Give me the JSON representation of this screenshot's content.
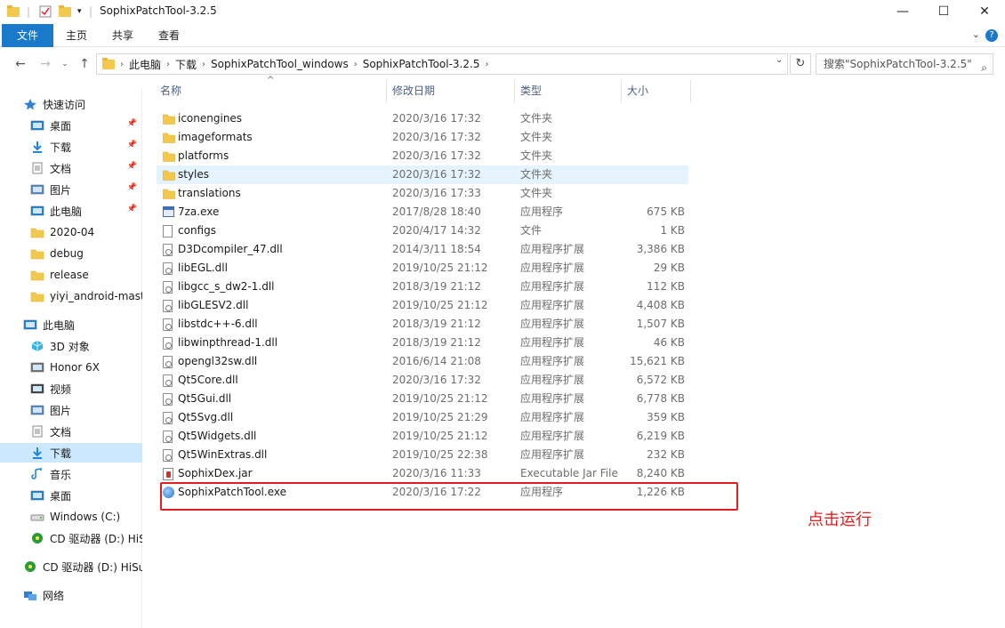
{
  "window": {
    "title": "SophixPatchTool-3.2.5",
    "controls": {
      "minimize": "—",
      "maximize": "☐",
      "close": "✕"
    }
  },
  "ribbon": {
    "tabs": [
      "文件",
      "主页",
      "共享",
      "查看"
    ]
  },
  "address": {
    "crumbs": [
      "此电脑",
      "下载",
      "SophixPatchTool_windows",
      "SophixPatchTool-3.2.5"
    ],
    "search_placeholder": "搜索\"SophixPatchTool-3.2.5\""
  },
  "sidebar": {
    "items": [
      {
        "label": "快速访问",
        "icon": "star-icon",
        "pinned": false
      },
      {
        "label": "桌面",
        "icon": "desktop-icon",
        "pinned": true
      },
      {
        "label": "下载",
        "icon": "download-icon",
        "pinned": true
      },
      {
        "label": "文档",
        "icon": "document-icon",
        "pinned": true
      },
      {
        "label": "图片",
        "icon": "picture-icon",
        "pinned": true
      },
      {
        "label": "此电脑",
        "icon": "computer-icon",
        "pinned": true
      },
      {
        "label": "2020-04",
        "icon": "folder-icon",
        "pinned": false
      },
      {
        "label": "debug",
        "icon": "folder-icon",
        "pinned": false
      },
      {
        "label": "release",
        "icon": "folder-icon",
        "pinned": false
      },
      {
        "label": "yiyi_android-mast",
        "icon": "folder-icon",
        "pinned": false
      },
      {
        "label": "此电脑",
        "icon": "computer-icon",
        "pinned": false
      },
      {
        "label": "3D 对象",
        "icon": "cube-icon",
        "pinned": false
      },
      {
        "label": "Honor 6X",
        "icon": "phone-icon",
        "pinned": false
      },
      {
        "label": "视频",
        "icon": "video-icon",
        "pinned": false
      },
      {
        "label": "图片",
        "icon": "picture-icon",
        "pinned": false
      },
      {
        "label": "文档",
        "icon": "document-icon",
        "pinned": false
      },
      {
        "label": "下载",
        "icon": "download-icon",
        "pinned": false
      },
      {
        "label": "音乐",
        "icon": "music-icon",
        "pinned": false
      },
      {
        "label": "桌面",
        "icon": "desktop-icon",
        "pinned": false
      },
      {
        "label": "Windows (C:)",
        "icon": "drive-icon",
        "pinned": false
      },
      {
        "label": "CD 驱动器 (D:) HiS",
        "icon": "cd-icon",
        "pinned": false
      },
      {
        "label": "CD 驱动器 (D:) HiSu",
        "icon": "cd-icon",
        "pinned": false
      },
      {
        "label": "网络",
        "icon": "network-icon",
        "pinned": false
      }
    ]
  },
  "columns": {
    "name": "名称",
    "date": "修改日期",
    "type": "类型",
    "size": "大小"
  },
  "files": [
    {
      "name": "iconengines",
      "date": "2020/3/16 17:32",
      "type": "文件夹",
      "size": "",
      "icon": "folder-icon"
    },
    {
      "name": "imageformats",
      "date": "2020/3/16 17:32",
      "type": "文件夹",
      "size": "",
      "icon": "folder-icon"
    },
    {
      "name": "platforms",
      "date": "2020/3/16 17:32",
      "type": "文件夹",
      "size": "",
      "icon": "folder-icon"
    },
    {
      "name": "styles",
      "date": "2020/3/16 17:32",
      "type": "文件夹",
      "size": "",
      "icon": "folder-icon"
    },
    {
      "name": "translations",
      "date": "2020/3/16 17:33",
      "type": "文件夹",
      "size": "",
      "icon": "folder-icon"
    },
    {
      "name": "7za.exe",
      "date": "2017/8/28 18:40",
      "type": "应用程序",
      "size": "675 KB",
      "icon": "exe-icon"
    },
    {
      "name": "configs",
      "date": "2020/4/17 14:32",
      "type": "文件",
      "size": "1 KB",
      "icon": "file-icon"
    },
    {
      "name": "D3Dcompiler_47.dll",
      "date": "2014/3/11 18:54",
      "type": "应用程序扩展",
      "size": "3,386 KB",
      "icon": "dll-icon"
    },
    {
      "name": "libEGL.dll",
      "date": "2019/10/25 21:12",
      "type": "应用程序扩展",
      "size": "29 KB",
      "icon": "dll-icon"
    },
    {
      "name": "libgcc_s_dw2-1.dll",
      "date": "2018/3/19 21:12",
      "type": "应用程序扩展",
      "size": "112 KB",
      "icon": "dll-icon"
    },
    {
      "name": "libGLESV2.dll",
      "date": "2019/10/25 21:12",
      "type": "应用程序扩展",
      "size": "4,408 KB",
      "icon": "dll-icon"
    },
    {
      "name": "libstdc++-6.dll",
      "date": "2018/3/19 21:12",
      "type": "应用程序扩展",
      "size": "1,507 KB",
      "icon": "dll-icon"
    },
    {
      "name": "libwinpthread-1.dll",
      "date": "2018/3/19 21:12",
      "type": "应用程序扩展",
      "size": "46 KB",
      "icon": "dll-icon"
    },
    {
      "name": "opengl32sw.dll",
      "date": "2016/6/14 21:08",
      "type": "应用程序扩展",
      "size": "15,621 KB",
      "icon": "dll-icon"
    },
    {
      "name": "Qt5Core.dll",
      "date": "2020/3/16 17:32",
      "type": "应用程序扩展",
      "size": "6,572 KB",
      "icon": "dll-icon"
    },
    {
      "name": "Qt5Gui.dll",
      "date": "2019/10/25 21:12",
      "type": "应用程序扩展",
      "size": "6,778 KB",
      "icon": "dll-icon"
    },
    {
      "name": "Qt5Svg.dll",
      "date": "2019/10/25 21:29",
      "type": "应用程序扩展",
      "size": "359 KB",
      "icon": "dll-icon"
    },
    {
      "name": "Qt5Widgets.dll",
      "date": "2019/10/25 21:12",
      "type": "应用程序扩展",
      "size": "6,219 KB",
      "icon": "dll-icon"
    },
    {
      "name": "Qt5WinExtras.dll",
      "date": "2019/10/25 22:38",
      "type": "应用程序扩展",
      "size": "232 KB",
      "icon": "dll-icon"
    },
    {
      "name": "SophixDex.jar",
      "date": "2020/3/16 11:33",
      "type": "Executable Jar File",
      "size": "8,240 KB",
      "icon": "jar-icon"
    },
    {
      "name": "SophixPatchTool.exe",
      "date": "2020/3/16 17:22",
      "type": "应用程序",
      "size": "1,226 KB",
      "icon": "app-icon"
    }
  ],
  "annotation": {
    "text": "点击运行",
    "color": "#e02020"
  },
  "colors": {
    "accent": "#1979ca",
    "selected": "#cce8ff",
    "hover": "#e5f3ff",
    "folder": "#f3c94d"
  }
}
